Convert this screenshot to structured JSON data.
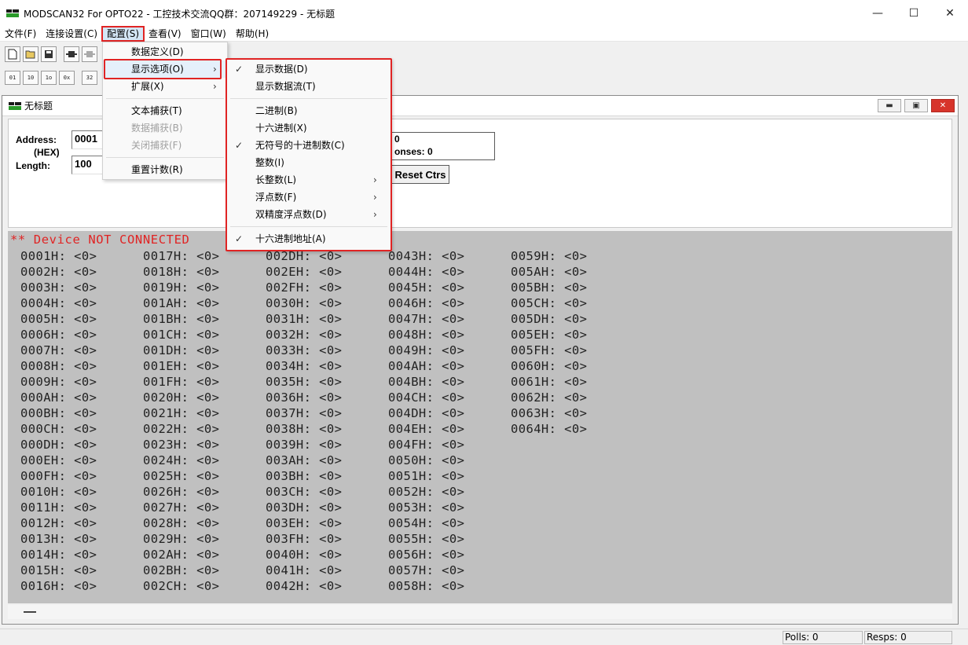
{
  "window": {
    "title": "MODSCAN32 For OPTO22 - 工控技术交流QQ群：207149229 - 无标题",
    "minimize": "—",
    "maximize": "☐",
    "close": "✕"
  },
  "menubar": {
    "items": [
      "文件(F)",
      "连接设置(C)",
      "配置(S)",
      "查看(V)",
      "窗口(W)",
      "帮助(H)"
    ]
  },
  "toolbar1": {
    "buttons": [
      "new",
      "open",
      "save",
      "connect",
      "disconnect"
    ]
  },
  "toolbar2": {
    "buttons": [
      "01",
      "10",
      "1o",
      "0x",
      "32"
    ]
  },
  "child": {
    "title": "无标题",
    "address_label": "Address:",
    "hex_label": "(HEX)",
    "length_label": "Length:",
    "address_value": "0001",
    "length_value": "100",
    "polls_text": "0",
    "responses_text": "onses: 0",
    "reset_label": "Reset Ctrs",
    "status_text": "** Device NOT CONNECTED"
  },
  "registers": {
    "columns": [
      [
        "0001H: <0>",
        "0002H: <0>",
        "0003H: <0>",
        "0004H: <0>",
        "0005H: <0>",
        "0006H: <0>",
        "0007H: <0>",
        "0008H: <0>",
        "0009H: <0>",
        "000AH: <0>",
        "000BH: <0>",
        "000CH: <0>",
        "000DH: <0>",
        "000EH: <0>",
        "000FH: <0>",
        "0010H: <0>",
        "0011H: <0>",
        "0012H: <0>",
        "0013H: <0>",
        "0014H: <0>",
        "0015H: <0>",
        "0016H: <0>"
      ],
      [
        "0017H: <0>",
        "0018H: <0>",
        "0019H: <0>",
        "001AH: <0>",
        "001BH: <0>",
        "001CH: <0>",
        "001DH: <0>",
        "001EH: <0>",
        "001FH: <0>",
        "0020H: <0>",
        "0021H: <0>",
        "0022H: <0>",
        "0023H: <0>",
        "0024H: <0>",
        "0025H: <0>",
        "0026H: <0>",
        "0027H: <0>",
        "0028H: <0>",
        "0029H: <0>",
        "002AH: <0>",
        "002BH: <0>",
        "002CH: <0>"
      ],
      [
        "002DH: <0>",
        "002EH: <0>",
        "002FH: <0>",
        "0030H: <0>",
        "0031H: <0>",
        "0032H: <0>",
        "0033H: <0>",
        "0034H: <0>",
        "0035H: <0>",
        "0036H: <0>",
        "0037H: <0>",
        "0038H: <0>",
        "0039H: <0>",
        "003AH: <0>",
        "003BH: <0>",
        "003CH: <0>",
        "003DH: <0>",
        "003EH: <0>",
        "003FH: <0>",
        "0040H: <0>",
        "0041H: <0>",
        "0042H: <0>"
      ],
      [
        "0043H: <0>",
        "0044H: <0>",
        "0045H: <0>",
        "0046H: <0>",
        "0047H: <0>",
        "0048H: <0>",
        "0049H: <0>",
        "004AH: <0>",
        "004BH: <0>",
        "004CH: <0>",
        "004DH: <0>",
        "004EH: <0>",
        "004FH: <0>",
        "0050H: <0>",
        "0051H: <0>",
        "0052H: <0>",
        "0053H: <0>",
        "0054H: <0>",
        "0055H: <0>",
        "0056H: <0>",
        "0057H: <0>",
        "0058H: <0>"
      ],
      [
        "0059H: <0>",
        "005AH: <0>",
        "005BH: <0>",
        "005CH: <0>",
        "005DH: <0>",
        "005EH: <0>",
        "005FH: <0>",
        "0060H: <0>",
        "0061H: <0>",
        "0062H: <0>",
        "0063H: <0>",
        "0064H: <0>"
      ]
    ]
  },
  "config_menu": {
    "items": [
      {
        "label": "数据定义(D)",
        "disabled": false
      },
      {
        "label": "显示选项(O)",
        "disabled": false,
        "submenu": true
      },
      {
        "label": "扩展(X)",
        "disabled": false,
        "submenu": true
      },
      {
        "label": "文本捕获(T)",
        "disabled": false
      },
      {
        "label": "数据捕获(B)",
        "disabled": true
      },
      {
        "label": "关闭捕获(F)",
        "disabled": true
      },
      {
        "label": "重置计数(R)",
        "disabled": false
      }
    ]
  },
  "display_menu": {
    "items": [
      {
        "label": "显示数据(D)",
        "checked": true
      },
      {
        "label": "显示数据流(T)",
        "checked": false
      },
      {
        "label": "二进制(B)",
        "checked": false
      },
      {
        "label": "十六进制(X)",
        "checked": false
      },
      {
        "label": "无符号的十进制数(C)",
        "checked": true
      },
      {
        "label": "整数(I)",
        "checked": false
      },
      {
        "label": "长整数(L)",
        "checked": false,
        "submenu": true
      },
      {
        "label": "浮点数(F)",
        "checked": false,
        "submenu": true
      },
      {
        "label": "双精度浮点数(D)",
        "checked": false,
        "submenu": true
      },
      {
        "label": "十六进制地址(A)",
        "checked": true
      }
    ]
  },
  "statusbar": {
    "polls": "Polls: 0",
    "resps": "Resps: 0"
  },
  "colors": {
    "highlight": "#e02424",
    "data_bg": "#c0c0c0",
    "status_red": "#e02424"
  }
}
